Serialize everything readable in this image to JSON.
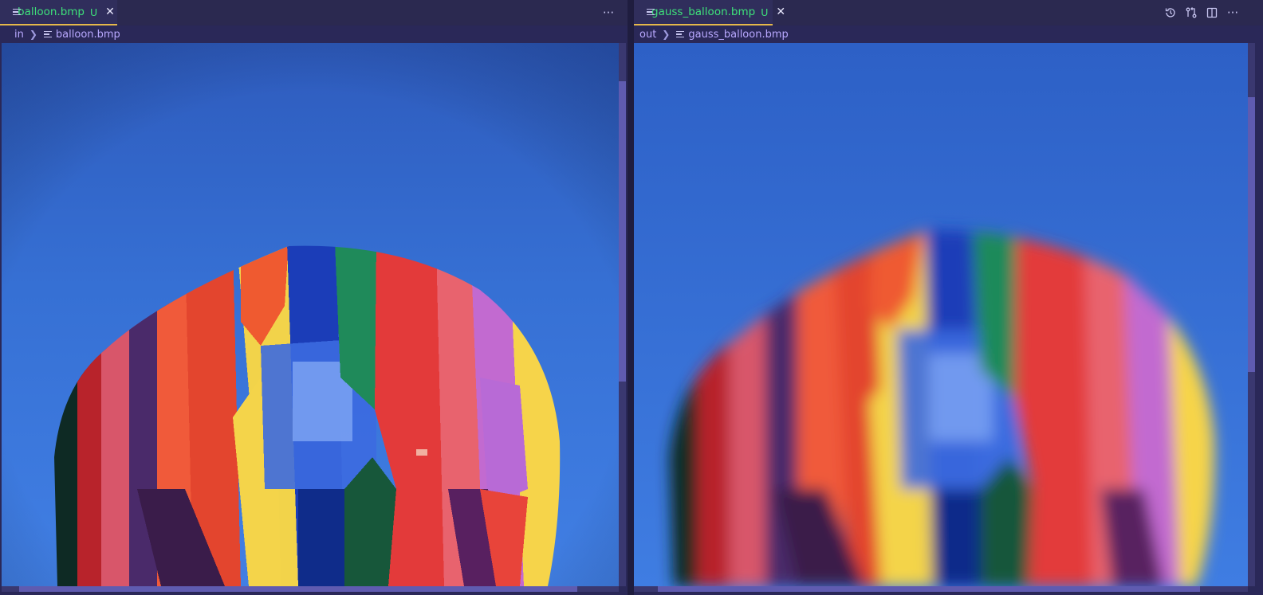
{
  "left_editor": {
    "tab": {
      "label": "balloon.bmp",
      "status": "U",
      "icon": "file-lines-icon",
      "close": "✕"
    },
    "more_actions": "···",
    "breadcrumb": {
      "folder": "in",
      "file": "balloon.bmp"
    },
    "image": {
      "description": "balloon",
      "rendering": "pixelated"
    }
  },
  "right_editor": {
    "tab": {
      "label": "gauss_balloon.bmp",
      "status": "U",
      "icon": "file-lines-icon",
      "close": "✕"
    },
    "actions": [
      "history-icon",
      "compare-changes-icon",
      "split-editor-icon",
      "more-icon"
    ],
    "more_actions": "···",
    "breadcrumb": {
      "folder": "out",
      "file": "gauss_balloon.bmp"
    },
    "image": {
      "description": "gaussian blurred balloon",
      "rendering": "blurred"
    }
  },
  "colors": {
    "sky": "#3f7be0",
    "tab_accent": "#e5b84a",
    "untracked_green": "#3ee07a",
    "breadcrumb_text": "#b9a9ff"
  }
}
